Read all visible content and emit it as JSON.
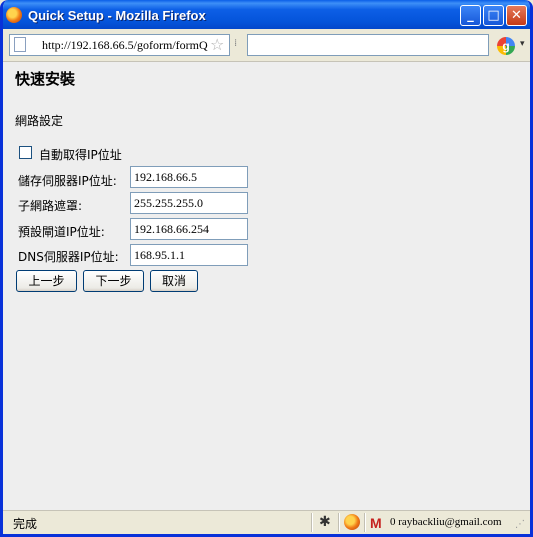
{
  "window": {
    "title": "Quick Setup - Mozilla Firefox"
  },
  "icons": {
    "app": "firefox-icon",
    "page": "page-icon",
    "bookmark": "star-icon",
    "search_engine": "google-icon",
    "status_bug": "bug-icon",
    "status_app": "firefox-icon",
    "mail": "gmail-icon"
  },
  "titlebar_buttons": {
    "minimize": "_",
    "maximize": "□",
    "close": "✕"
  },
  "navbar": {
    "url": "http://192.168.66.5/goform/formQ",
    "search_value": ""
  },
  "page": {
    "title": "快速安裝",
    "section": "網路設定",
    "checkbox": {
      "label": "自動取得IP位址",
      "checked": false
    },
    "fields": [
      {
        "label": "儲存伺服器IP位址:",
        "value": "192.168.66.5"
      },
      {
        "label": "子網路遮罩:",
        "value": "255.255.255.0"
      },
      {
        "label": "預設閘道IP位址:",
        "value": "192.168.66.254"
      },
      {
        "label": "DNS伺服器IP位址:",
        "value": "168.95.1.1"
      }
    ],
    "buttons": {
      "prev": "上一步",
      "next": "下一步",
      "cancel": "取消"
    }
  },
  "statusbar": {
    "status": "完成",
    "gmail": "0 raybackliu@gmail.com"
  },
  "colors": {
    "titlebar": "#0453d9",
    "content_bg": "#eeeeee",
    "chrome": "#ece9d8",
    "input_border": "#7f9db9",
    "button_border": "#003c74"
  }
}
